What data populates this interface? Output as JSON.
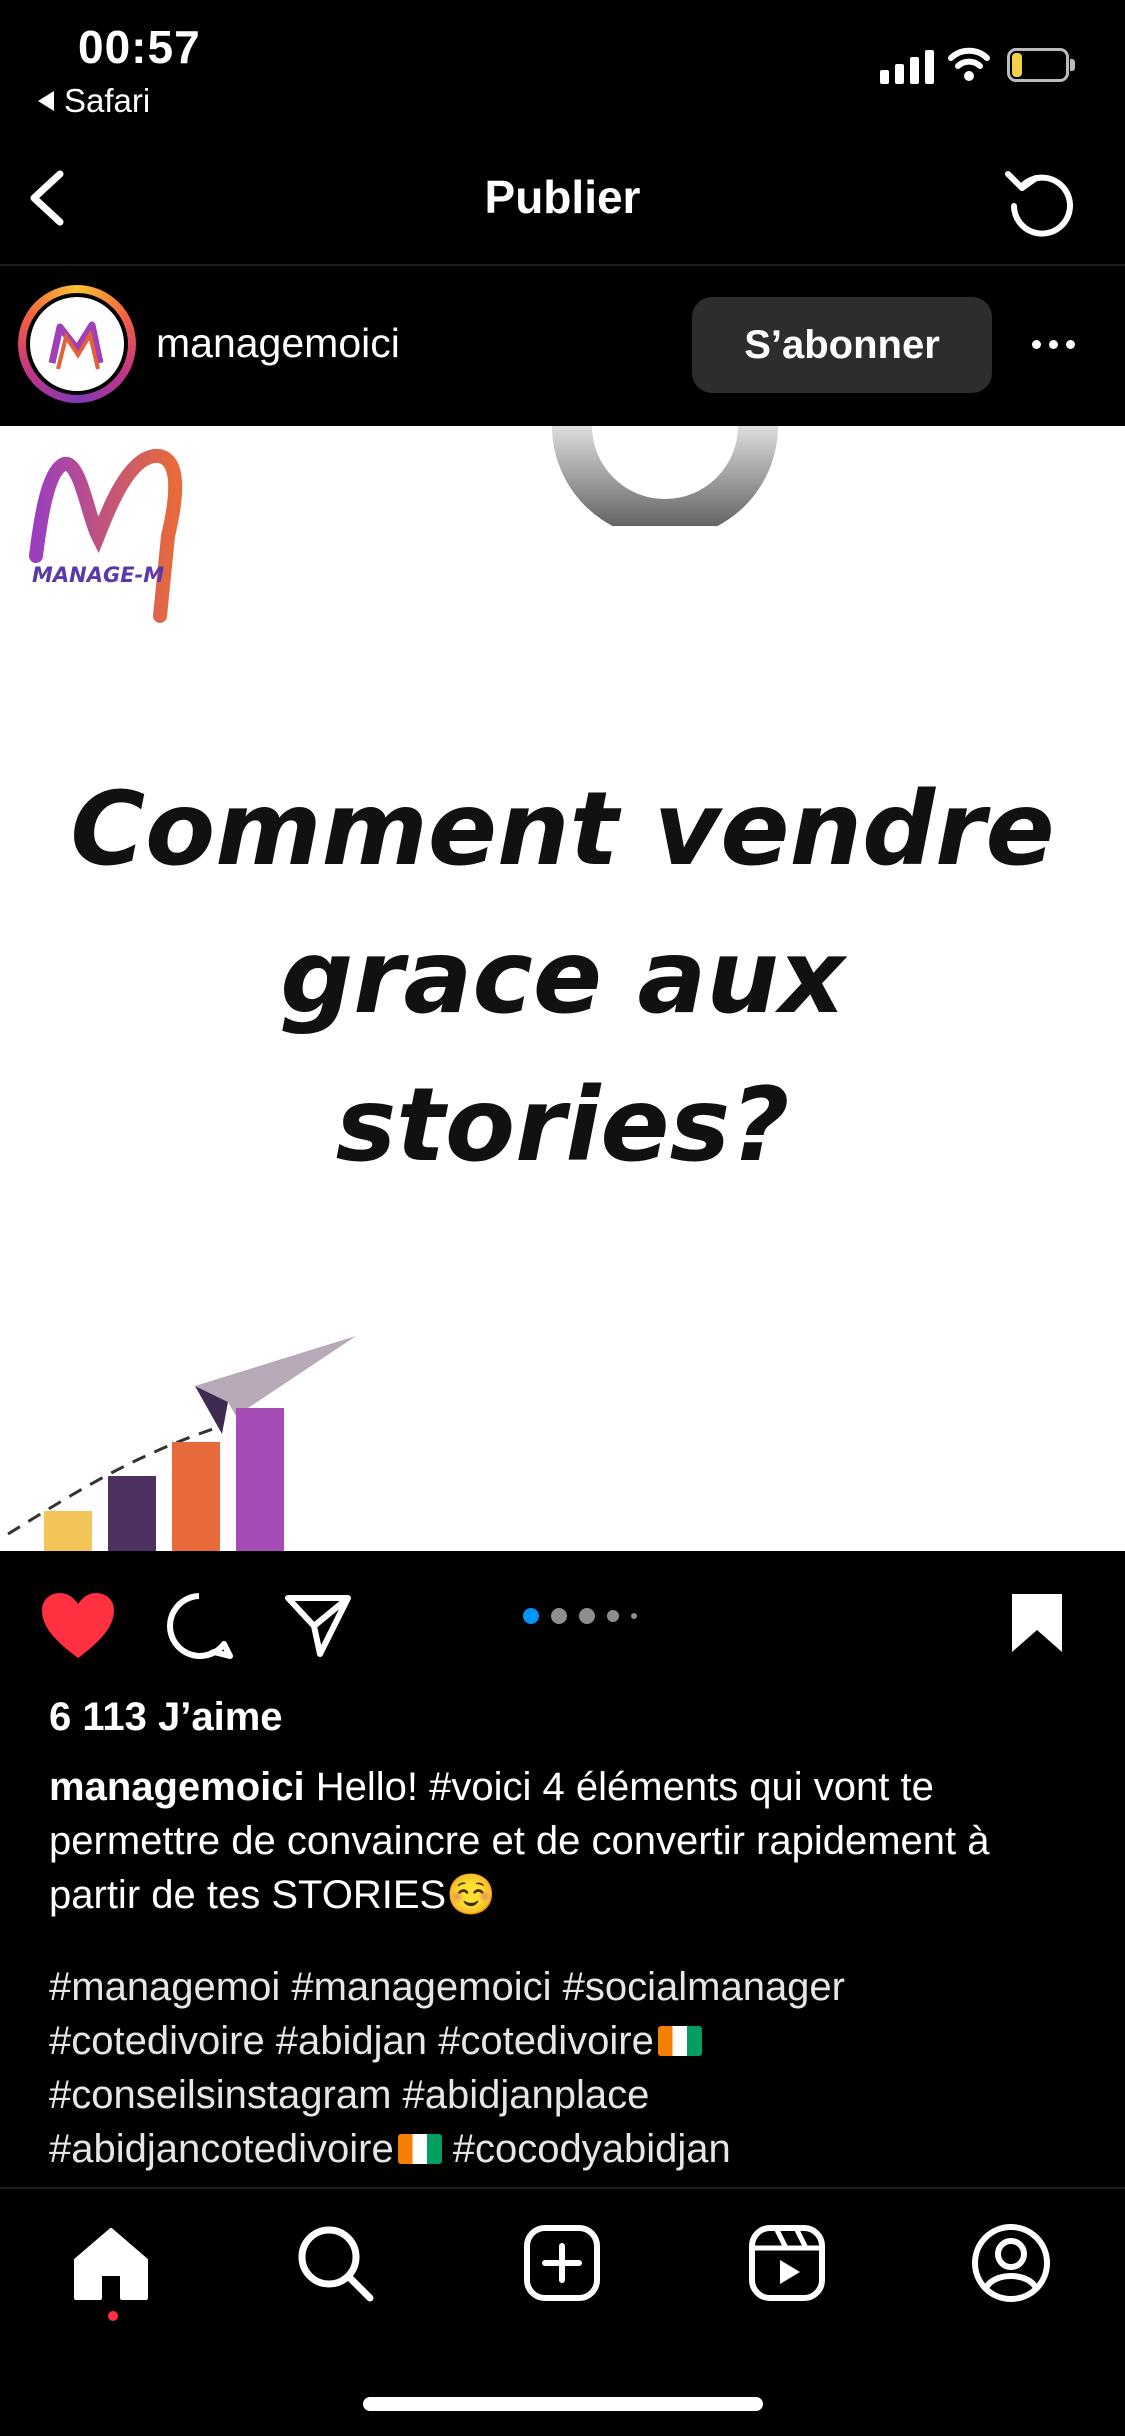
{
  "status_bar": {
    "time": "00:57",
    "back_app": "Safari",
    "battery": "6"
  },
  "nav": {
    "title": "Publier"
  },
  "post": {
    "username": "managemoici",
    "follow_label": "S’abonner",
    "image": {
      "logo_text": "MANAGE-M",
      "headline": [
        "Comment vendre",
        "grace aux",
        "stories?"
      ]
    },
    "carousel": {
      "count": 5,
      "active": 1
    },
    "likes": "6 113 J’aime",
    "caption": {
      "username": "managemoici",
      "text": " Hello! #voici 4 éléments qui vont te permettre de convaincre et de convertir rapidement à partir de tes STORIES☺️"
    },
    "hashtags": [
      "#managemoi #managemoici #socialmanager",
      "#cotedivoire #abidjan #cotedivoire",
      "#conseilsinstagram #abidjanplace",
      "#abidjancotedivoire",
      " #cocodyabidjan"
    ]
  },
  "tab_bar": {
    "items": [
      "home",
      "search",
      "create",
      "reels",
      "profile"
    ],
    "active": "home"
  },
  "colors": {
    "heart": "#ff3040",
    "accent_blue": "#0095f6",
    "follow_bg": "#2d2d2d"
  }
}
